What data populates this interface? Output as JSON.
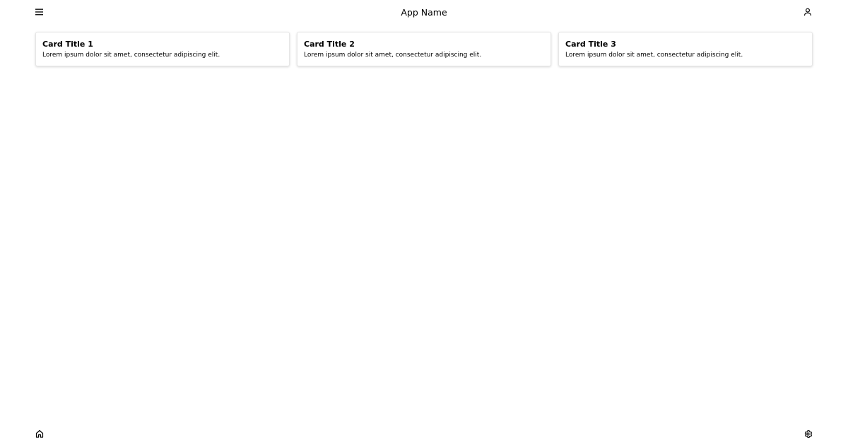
{
  "header": {
    "menu_icon": "menu-icon",
    "title": "App Name",
    "profile_icon": "user-icon"
  },
  "cards": [
    {
      "title": "Card Title 1",
      "text": "Lorem ipsum dolor sit amet, consectetur adipiscing elit."
    },
    {
      "title": "Card Title 2",
      "text": "Lorem ipsum dolor sit amet, consectetur adipiscing elit."
    },
    {
      "title": "Card Title 3",
      "text": "Lorem ipsum dolor sit amet, consectetur adipiscing elit."
    }
  ],
  "footer": {
    "home_icon": "home-icon",
    "settings_icon": "settings-icon"
  },
  "colors": {
    "background": "#ffffff",
    "text": "#000000",
    "card_border": "#e6e6e6"
  }
}
